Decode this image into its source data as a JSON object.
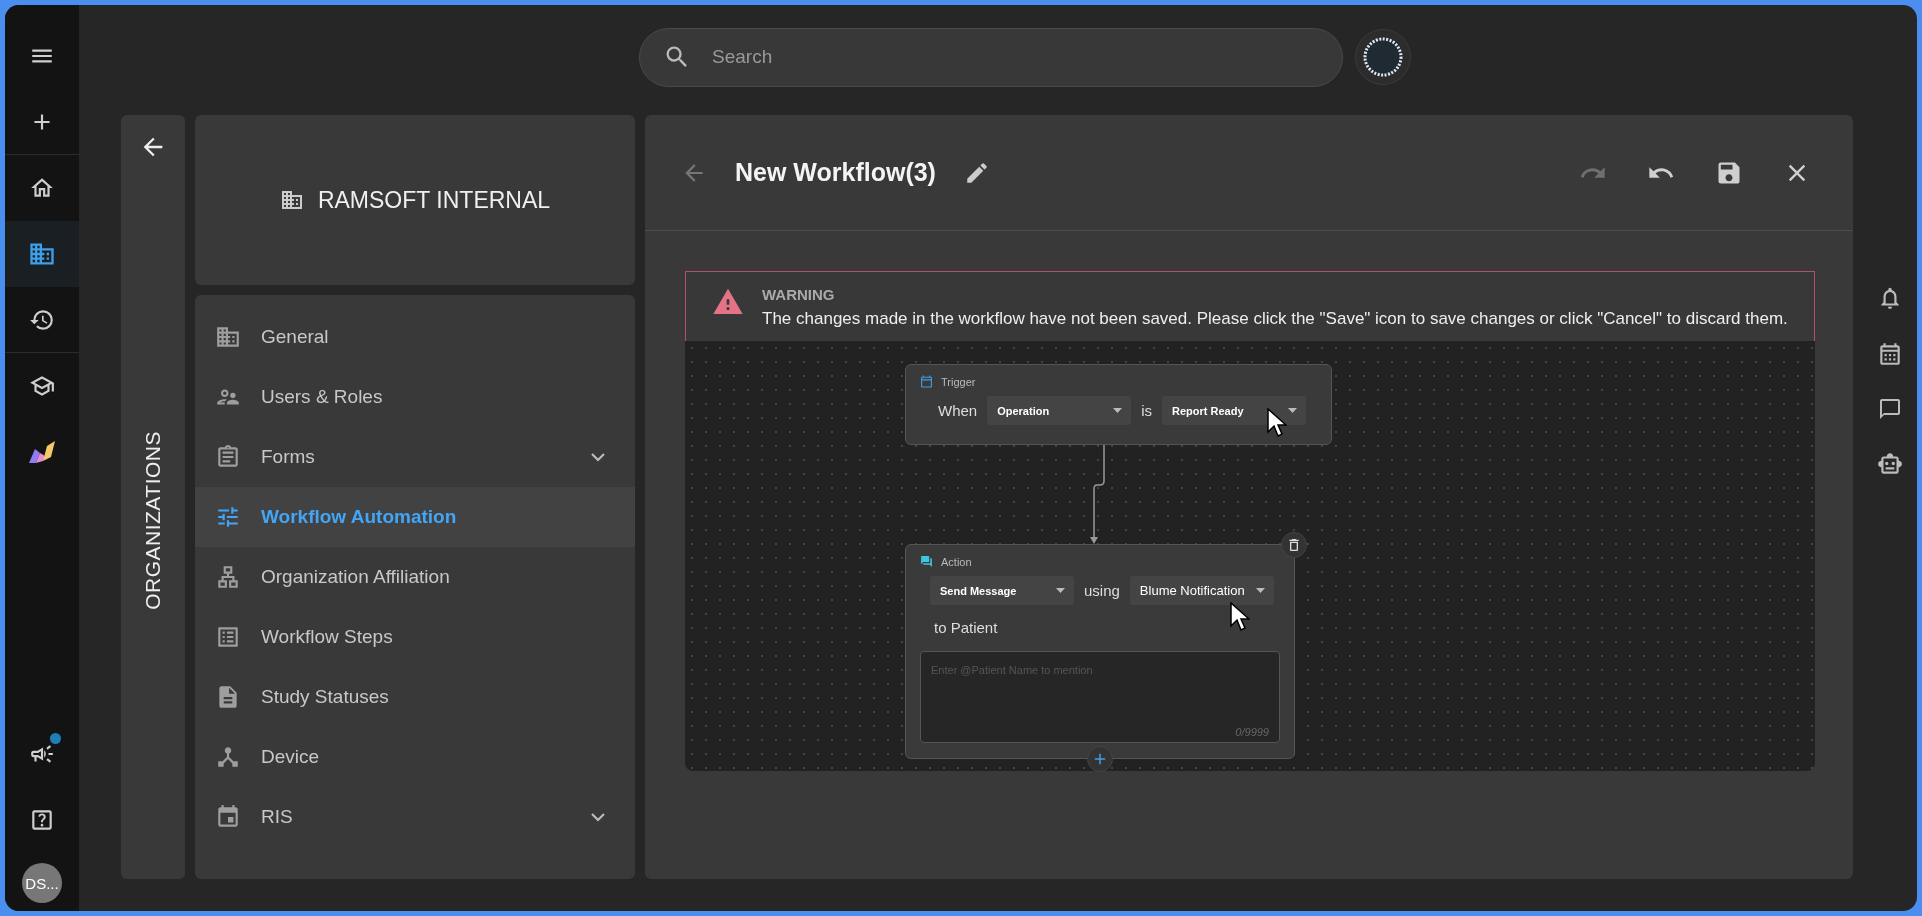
{
  "rail": {
    "items": [
      {
        "selected": false,
        "notified": false
      },
      {
        "selected": false,
        "notified": false
      },
      {
        "selected": false,
        "notified": false
      },
      {
        "selected": true,
        "notified": false
      },
      {
        "selected": false,
        "notified": false
      },
      {
        "selected": false,
        "notified": false
      },
      {
        "selected": false,
        "notified": false
      },
      {
        "selected": false,
        "notified": true
      },
      {
        "selected": false,
        "notified": false
      }
    ],
    "avatar": "DS..."
  },
  "search": {
    "placeholder": "Search"
  },
  "organizations_panel": {
    "title": "ORGANIZATIONS"
  },
  "organization": {
    "name": "RAMSOFT INTERNAL"
  },
  "menu": {
    "items": [
      {
        "label": "General",
        "kind": "page",
        "selected": false
      },
      {
        "label": "Users & Roles",
        "kind": "page",
        "selected": false
      },
      {
        "label": "Forms",
        "kind": "group",
        "expanded": false,
        "selected": false
      },
      {
        "label": "Workflow Automation",
        "kind": "page",
        "selected": true
      },
      {
        "label": "Organization Affiliation",
        "kind": "page",
        "selected": false
      },
      {
        "label": "Workflow Steps",
        "kind": "page",
        "selected": false
      },
      {
        "label": "Study Statuses",
        "kind": "page",
        "selected": false
      },
      {
        "label": "Device",
        "kind": "page",
        "selected": false
      },
      {
        "label": "RIS",
        "kind": "group",
        "expanded": false,
        "selected": false
      }
    ]
  },
  "workflow": {
    "title": "New Workflow(3)",
    "toolbar": [
      {
        "disabled": true
      },
      {
        "disabled": false
      },
      {
        "disabled": false
      },
      {
        "disabled": false
      }
    ],
    "warning": {
      "title": "WARNING",
      "message": "The changes made in the workflow have not been saved. Please click the \"Save\" icon to save changes or click \"Cancel\" to discard them."
    },
    "trigger": {
      "label": "Trigger",
      "when": "When",
      "field": "Operation",
      "is": "is",
      "value": "Report Ready"
    },
    "action": {
      "label": "Action",
      "field": "Send Message",
      "using": "using",
      "channel": "Blume Notification",
      "recipient": "to Patient",
      "placeholder": "Enter @Patient Name to mention",
      "counter": "0/9999"
    }
  }
}
